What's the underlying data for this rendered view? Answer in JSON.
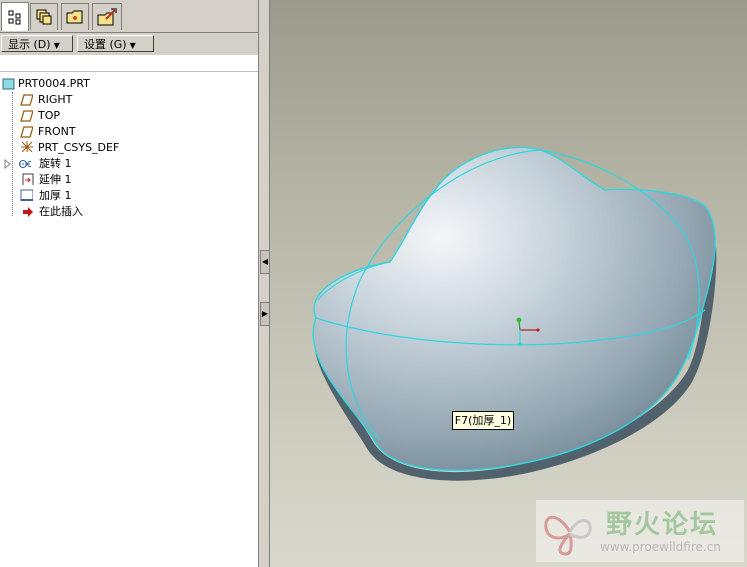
{
  "model_tree": {
    "tabs": [
      {
        "name": "model-tree"
      },
      {
        "name": "layers"
      },
      {
        "name": "folder-browser"
      },
      {
        "name": "favorites"
      },
      {
        "name": "tools"
      }
    ],
    "buttons": {
      "display_label": "显示 (D)",
      "settings_label": "设置 (G)"
    },
    "items": [
      {
        "label": "PRT0004.PRT",
        "icon": "part-icon"
      },
      {
        "label": "RIGHT",
        "icon": "datum-plane-icon"
      },
      {
        "label": "TOP",
        "icon": "datum-plane-icon"
      },
      {
        "label": "FRONT",
        "icon": "datum-plane-icon"
      },
      {
        "label": "PRT_CSYS_DEF",
        "icon": "coordinate-system-icon"
      },
      {
        "label": "旋转 1",
        "icon": "revolve-icon"
      },
      {
        "label": "延伸 1",
        "icon": "extend-icon"
      },
      {
        "label": "加厚 1",
        "icon": "thicken-icon"
      },
      {
        "label": "在此插入",
        "icon": "insert-here-arrow-icon"
      }
    ]
  },
  "viewport": {
    "tooltip": "F7(加厚_1)",
    "colors": {
      "edge": "#2fd6e0",
      "surface_light": "#f4f6f8",
      "surface_dark": "#6f8593",
      "background_top": "#9c9a8c",
      "background_bottom": "#d9d8cc"
    }
  },
  "watermark": {
    "title": "野火论坛",
    "url": "www.proewildfire.cn"
  }
}
